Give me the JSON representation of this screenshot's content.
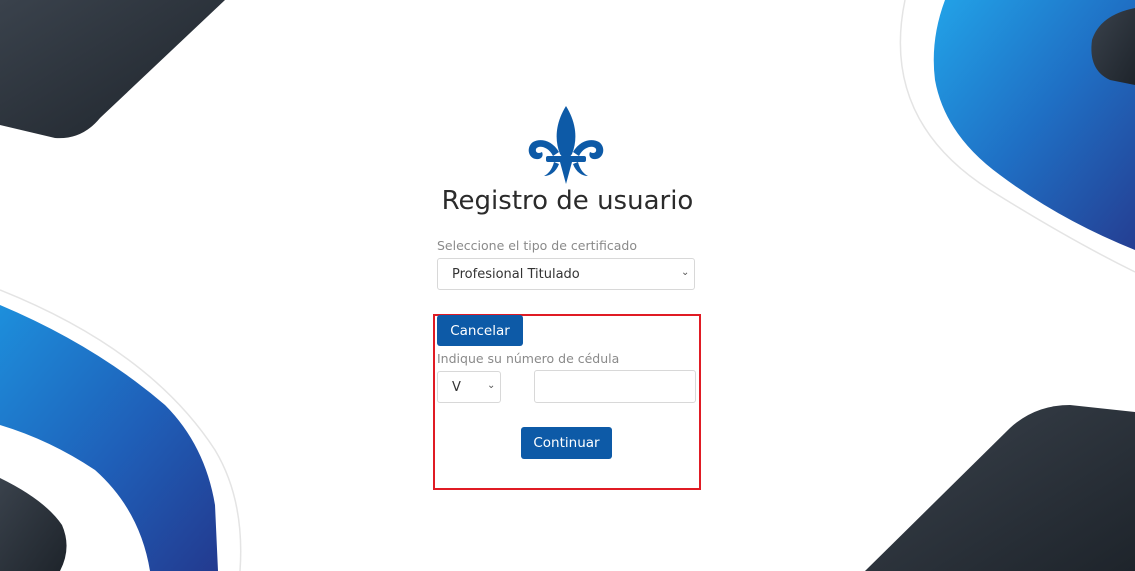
{
  "form": {
    "title": "Registro de usuario",
    "certificate_label": "Seleccione el tipo de certificado",
    "certificate_value": "Profesional Titulado",
    "cancel_label": "Cancelar",
    "id_label": "Indique su número de cédula",
    "id_type_value": "V",
    "id_number_value": "",
    "continue_label": "Continuar"
  },
  "colors": {
    "primary": "#0d5aa7",
    "highlight": "#e01b24",
    "shape_dark": "#2b323a",
    "shape_blue": "#1f79c6",
    "shape_light_blue": "#2aa7e6"
  },
  "icons": {
    "logo": "fleur-de-lis-icon",
    "select_caret": "chevron-down-icon"
  }
}
